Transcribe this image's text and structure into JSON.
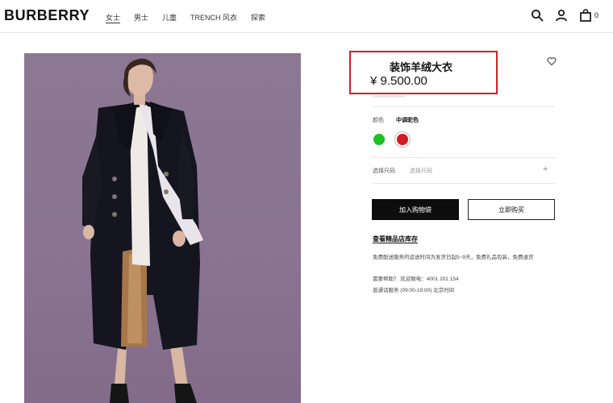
{
  "header": {
    "logo": "BURBERRY",
    "nav": [
      "女士",
      "男士",
      "儿童",
      "TRENCH 风衣",
      "探索"
    ],
    "cart_count": "0"
  },
  "product": {
    "title": "装饰羊绒大衣",
    "price": "¥ 9.500.00",
    "color_label": "颜色",
    "color_value": "中调驼色",
    "swatches": [
      "#1fbe24",
      "#d21b25"
    ],
    "size_label": "选择尺码",
    "size_placeholder": "选择尺码",
    "add_to_cart": "加入购物袋",
    "buy_now": "立即购买",
    "store_link": "查看精品店库存",
    "shipping_note": "免费配送服务的运送时间为发货日起5~9天，免费礼品包装，免费退货",
    "help_line": "需要帮助？ 欢迎致电：4001 201 154",
    "service_hours": "普通话服务 (09:00-19:00) 北京时间"
  },
  "colors": {
    "highlight_border": "#d22024",
    "button_dark": "#0d0d0d",
    "image_bg": "#8a7491"
  },
  "icons": [
    "search-icon",
    "account-icon",
    "shopping-bag-icon",
    "heart-icon",
    "plus-icon"
  ]
}
